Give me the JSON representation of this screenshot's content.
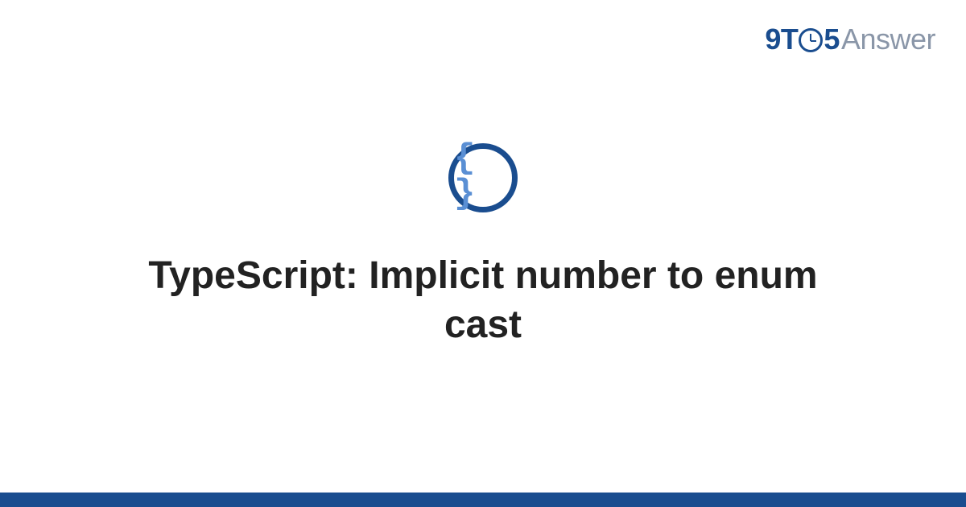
{
  "logo": {
    "part1": "9",
    "part2": "T",
    "part3": "5",
    "part4": "Answer"
  },
  "icon": {
    "glyph": "{ }",
    "name": "code-braces-icon"
  },
  "title": "TypeScript: Implicit number to enum cast",
  "colors": {
    "primary": "#1a4d8f",
    "muted": "#8a96a8",
    "brace": "#5a8fd4"
  }
}
